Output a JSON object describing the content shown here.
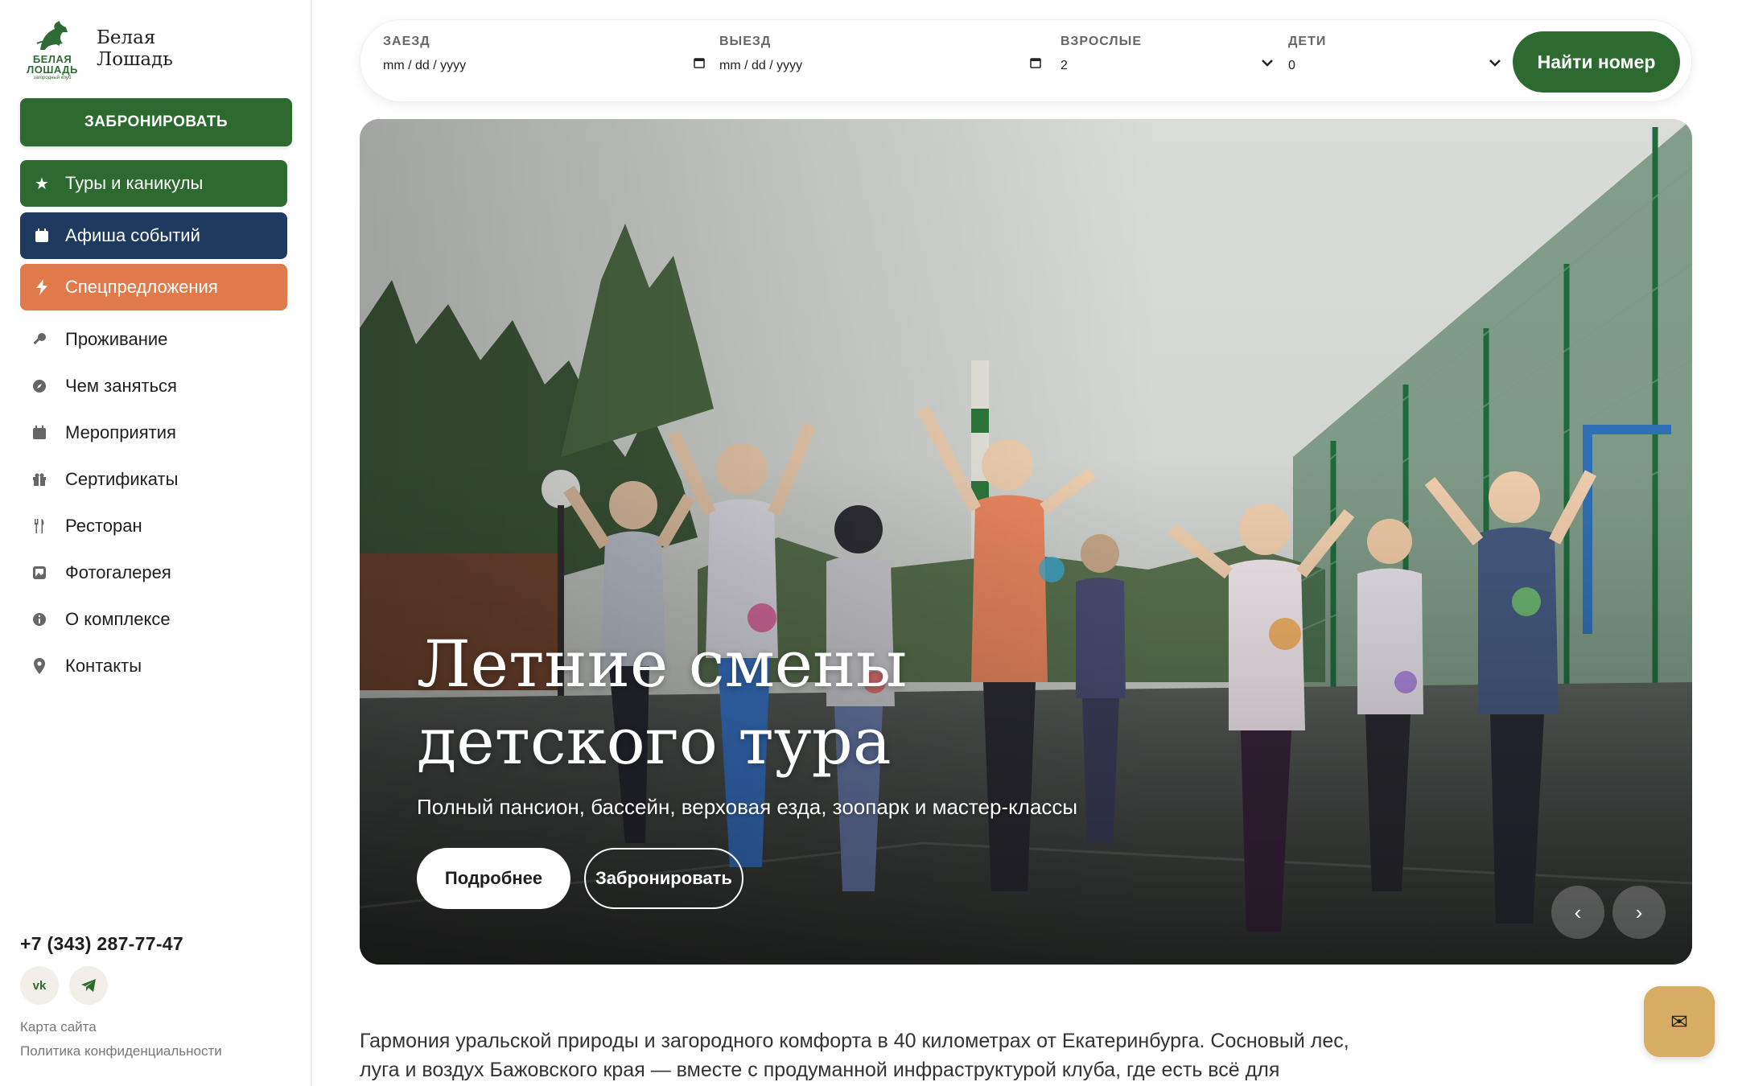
{
  "brand": {
    "name_line1": "Белая",
    "name_line2": "Лошадь",
    "logo_small_line1": "БЕЛАЯ",
    "logo_small_line2": "ЛОШАДЬ",
    "logo_small_sub": "загородный клуб",
    "color": "#2d6a2f"
  },
  "sidebar": {
    "book_button": "ЗАБРОНИРОВАТЬ",
    "highlights": [
      {
        "label": "Туры и каникулы",
        "icon": "star-icon",
        "color": "#2d6a2f"
      },
      {
        "label": "Афиша событий",
        "icon": "calendar-icon",
        "color": "#1e3a5f"
      },
      {
        "label": "Спецпредложения",
        "icon": "lightning-icon",
        "color": "#e07a4a"
      }
    ],
    "nav": [
      {
        "label": "Проживание",
        "icon": "key-icon"
      },
      {
        "label": "Чем заняться",
        "icon": "compass-icon"
      },
      {
        "label": "Мероприятия",
        "icon": "calendar-icon"
      },
      {
        "label": "Сертификаты",
        "icon": "gift-icon"
      },
      {
        "label": "Ресторан",
        "icon": "utensils-icon"
      },
      {
        "label": "Фотогалерея",
        "icon": "image-icon"
      },
      {
        "label": "О комплексе",
        "icon": "info-icon"
      },
      {
        "label": "Контакты",
        "icon": "map-pin-icon"
      }
    ],
    "phone": "+7 (343) 287-77-47",
    "social": {
      "vk": "vk",
      "telegram": "telegram-icon"
    },
    "footer_links": [
      "Карта сайта",
      "Политика конфиденциальности"
    ]
  },
  "booking": {
    "checkin": {
      "label": "ЗАЕЗД",
      "placeholder": "mm / dd / yyyy"
    },
    "checkout": {
      "label": "ВЫЕЗД",
      "placeholder": "mm / dd / yyyy"
    },
    "adults": {
      "label": "ВЗРОСЛЫЕ",
      "value": "2"
    },
    "children": {
      "label": "ДЕТИ",
      "value": "0"
    },
    "submit": "Найти номер"
  },
  "hero": {
    "title_line1": "Летние смены",
    "title_line2": "детского тура",
    "subtitle": "Полный пансион, бассейн, верховая езда, зоопарк и мастер-классы",
    "primary_button": "Подробнее",
    "secondary_button": "Забронировать",
    "prev_label": "‹",
    "next_label": "›"
  },
  "intro": {
    "text": "Гармония уральской природы и загородного комфорта в 40 километрах от Екатеринбурга. Сосновый лес, луга и воздух Бажовского края — вместе с продуманной инфраструктурой клуба, где есть всё для"
  },
  "chat": {
    "icon": "mail-icon",
    "glyph": "✉"
  }
}
